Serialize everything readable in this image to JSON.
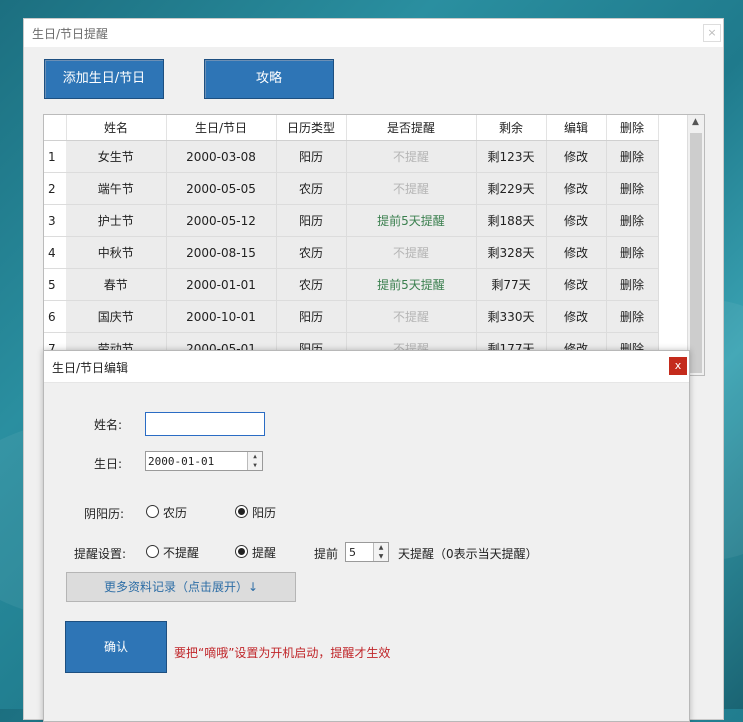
{
  "main_window": {
    "title": "生日/节日提醒",
    "close_glyph": "×",
    "add_button": "添加生日/节日",
    "guide_button": "攻略"
  },
  "table": {
    "headers": [
      "",
      "姓名",
      "生日/节日",
      "日历类型",
      "是否提醒",
      "剩余",
      "编辑",
      "删除"
    ],
    "rows": [
      {
        "idx": "1",
        "name": "女生节",
        "date": "2000-03-08",
        "calendar": "阳历",
        "remind": "不提醒",
        "remind_on": false,
        "remaining": "剩123天",
        "edit": "修改",
        "delete": "删除"
      },
      {
        "idx": "2",
        "name": "端午节",
        "date": "2000-05-05",
        "calendar": "农历",
        "remind": "不提醒",
        "remind_on": false,
        "remaining": "剩229天",
        "edit": "修改",
        "delete": "删除"
      },
      {
        "idx": "3",
        "name": "护士节",
        "date": "2000-05-12",
        "calendar": "阳历",
        "remind": "提前5天提醒",
        "remind_on": true,
        "remaining": "剩188天",
        "edit": "修改",
        "delete": "删除"
      },
      {
        "idx": "4",
        "name": "中秋节",
        "date": "2000-08-15",
        "calendar": "农历",
        "remind": "不提醒",
        "remind_on": false,
        "remaining": "剩328天",
        "edit": "修改",
        "delete": "删除"
      },
      {
        "idx": "5",
        "name": "春节",
        "date": "2000-01-01",
        "calendar": "农历",
        "remind": "提前5天提醒",
        "remind_on": true,
        "remaining": "剩77天",
        "edit": "修改",
        "delete": "删除"
      },
      {
        "idx": "6",
        "name": "国庆节",
        "date": "2000-10-01",
        "calendar": "阳历",
        "remind": "不提醒",
        "remind_on": false,
        "remaining": "剩330天",
        "edit": "修改",
        "delete": "删除"
      },
      {
        "idx": "7",
        "name": "劳动节",
        "date": "2000-05-01",
        "calendar": "阳历",
        "remind": "不提醒",
        "remind_on": false,
        "remaining": "剩177天",
        "edit": "修改",
        "delete": "删除"
      }
    ]
  },
  "dialog": {
    "title": "生日/节日编辑",
    "close_glyph": "x",
    "name_label": "姓名:",
    "name_value": "",
    "birthday_label": "生日:",
    "birthday_value": "2000-01-01",
    "calendar_label": "阴阳历:",
    "calendar_options": [
      "农历",
      "阳历"
    ],
    "calendar_selected": "阳历",
    "remind_label": "提醒设置:",
    "remind_options": [
      "不提醒",
      "提醒"
    ],
    "remind_selected": "提醒",
    "advance_label": "提前",
    "advance_days": "5",
    "advance_suffix": "天提醒（0表示当天提醒）",
    "expand_button": "更多资料记录（点击展开）↓",
    "confirm_button": "确认",
    "warning": "要把“嘀哦”设置为开机启动，提醒才生效"
  },
  "colors": {
    "accent_blue": "#2e75b6",
    "remind_green": "#3a7f4e",
    "muted_grey": "#b5b5b5",
    "warning_red": "#c0262a",
    "close_red": "#c42b1c"
  }
}
